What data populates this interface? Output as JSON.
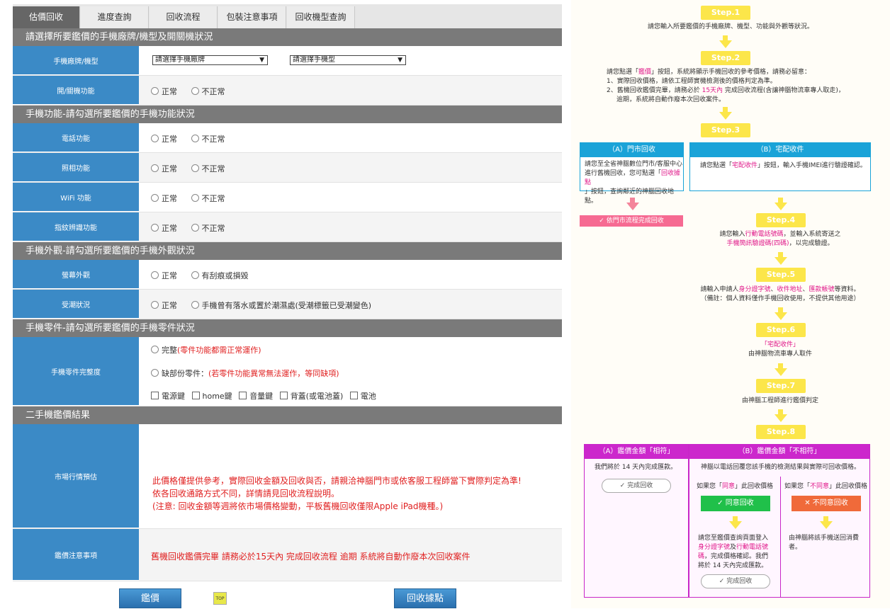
{
  "tabs": [
    "估價回收",
    "進度查詢",
    "回收流程",
    "包裝注意事項",
    "回收機型查詢"
  ],
  "sections": {
    "brand": "請選擇所要鑑價的手機廠牌/機型及開關機狀況",
    "functions": "手機功能-請勾選所要鑑價的手機功能狀況",
    "appearance": "手機外觀-請勾選所要鑑價的手機外觀狀況",
    "parts": "手機零件-請勾選所要鑑價的手機零件狀況",
    "result": "二手機鑑價結果"
  },
  "labels": {
    "brand_model": "手機廠牌/機型",
    "power": "開/關機功能",
    "phone": "電話功能",
    "camera": "照相功能",
    "wifi": "WiFi 功能",
    "fingerprint": "指紋辨識功能",
    "screen": "螢幕外觀",
    "moisture": "受潮狀況",
    "parts_complete": "手機零件完整度",
    "market": "市場行情預估",
    "notes": "鑑價注意事項"
  },
  "selects": {
    "brand_placeholder": "請選擇手機廠牌",
    "model_placeholder": "請選擇手機型"
  },
  "options": {
    "normal": "正常",
    "abnormal": "不正常",
    "scratched": "有刮痕或損毀",
    "wet": "手機曾有落水或置於潮濕處(受潮標籤已受潮變色)",
    "complete": "完整",
    "complete_note": "(零件功能都需正常運作)",
    "missing": "缺部份零件：",
    "missing_note": "(若零件功能異常無法運作，等同缺項)",
    "power_key": "電源鍵",
    "home_key": "home鍵",
    "volume_key": "音量鍵",
    "back_cover": "背蓋(或電池蓋)",
    "battery": "電池"
  },
  "notice": {
    "line1": "此價格僅提供參考，實際回收金額及回收與否，請親洽神腦門市或依客服工程師當下實際判定為準!",
    "line2": "依各回收通路方式不同，詳情請見回收流程說明。",
    "line3": "(注意: 回收金額等週將依市場價格變動，平板舊機回收僅限Apple iPad機種。)"
  },
  "notes_text": "舊機回收鑑價完畢 請務必於15天內 完成回收流程 逾期 系統將自動作廢本次回收案件",
  "buttons": {
    "appraise": "鑑價",
    "top": "TOP",
    "locations": "回收據點"
  },
  "flow": {
    "step1": "Step.1",
    "step1_text": "請您輸入所要鑑價的手機廠牌、機型、功能與外觀等狀況。",
    "step2": "Step.2",
    "step2_a": "請您點選「",
    "step2_b": "鑑價",
    "step2_c": "」按鈕，系統將顯示手機回收的參考價格，請務必留意：",
    "step2_1": "1、實際回收價格，請依工程師實機檢測後的價格判定為準。",
    "step2_2a": "2、舊機回收鑑價完畢，請務必於 ",
    "step2_2b": "15天內",
    "step2_2c": " 完成回收流程(含讓神腦物流車專人取走)，",
    "step2_3": "逾期，系統將自動作廢本次回收案件。",
    "step3": "Step.3",
    "store_head": "（A）門市回收",
    "store_text1": "請您至全省神腦數位門市/客服中心",
    "store_text2a": "進行舊機回收，您可點選「",
    "store_text2b": "回收據點",
    "store_text3": "」按鈕，查詢鄰近的神腦回收地點。",
    "store_btn": "依門市流程完成回收",
    "home_head": "（B）宅配收件",
    "home_text_a": "請您點選「",
    "home_text_b": "宅配收件",
    "home_text_c": "」按鈕，輸入手機IMEI進行驗證確認。",
    "step4": "Step.4",
    "step4_a": "請您輸入",
    "step4_b": "行動電話號碼",
    "step4_c": "，並輸入系統寄送之",
    "step4_d": "手機簡訊驗證碼(四碼)",
    "step4_e": "，以完成驗證。",
    "step5": "Step.5",
    "step5_a": "請輸入申請人",
    "step5_b": "身分證字號",
    "step5_c": "、",
    "step5_d": "收件地址",
    "step5_e": "、",
    "step5_f": "匯款帳號",
    "step5_g": "等資料。",
    "step5_note": "（備註：個人資料僅作手機回收使用，不提供其他用途）",
    "step6": "Step.6",
    "step6_a": "「宅配收件」",
    "step6_b": "由神腦物流車專人取件",
    "step7": "Step.7",
    "step7_text": "由神腦工程師進行鑑價判定",
    "step8": "Step.8",
    "match_head": "（A）鑑價金額「相符」",
    "match_text": "我們將於 14 天內完成匯款。",
    "done": "完成回收",
    "nomatch_head": "（B）鑑價金額「不相符」",
    "nomatch_text": "神腦以電話回覆您該手機的檢測結果與實際可回收價格。",
    "agree_a": "如果您「",
    "agree_b": "同意",
    "agree_c": "」此回收價格",
    "disagree_a": "如果您「",
    "disagree_b": "不同意",
    "disagree_c": "」此回收價格",
    "agree_btn": "同意回收",
    "disagree_btn": "不同意回收",
    "agree_t1": "請您至鑑價查詢頁面登入",
    "agree_t2a": "身分證字號",
    "agree_t2b": "及",
    "agree_t2c": "行動電話號",
    "agree_t3a": "碼",
    "agree_t3b": "，完成價格確認。我們",
    "agree_t4": "將於 14 天內完成匯款。",
    "disagree_t1": "由神腦將該手機送回消費",
    "disagree_t2": "者。"
  }
}
